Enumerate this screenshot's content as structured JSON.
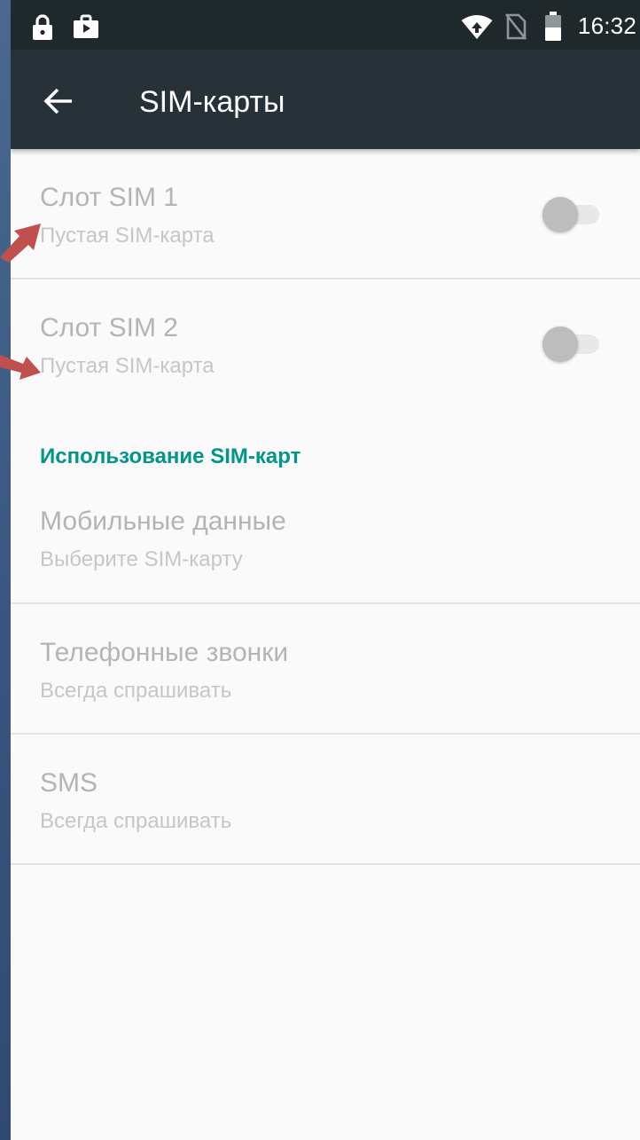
{
  "status_bar": {
    "time": "16:32",
    "icons": [
      "lock-icon",
      "shopping-bag-icon",
      "wifi-icon",
      "no-sim-icon",
      "battery-icon"
    ]
  },
  "app_bar": {
    "title": "SIM-карты",
    "back_icon": "arrow-back-icon"
  },
  "sim_slots": [
    {
      "title": "Слот SIM 1",
      "subtitle": "Пустая SIM-карта",
      "enabled": false
    },
    {
      "title": "Слот SIM 2",
      "subtitle": "Пустая SIM-карта",
      "enabled": false
    }
  ],
  "usage_section": {
    "header": "Использование SIM-карт",
    "items": [
      {
        "title": "Мобильные данные",
        "subtitle": "Выберите SIM-карту"
      },
      {
        "title": "Телефонные звонки",
        "subtitle": "Всегда спрашивать"
      },
      {
        "title": "SMS",
        "subtitle": "Всегда спрашивать"
      }
    ]
  },
  "colors": {
    "status_bar": "#1f292c",
    "app_bar": "#263238",
    "accent": "#009688",
    "background": "#fafafa",
    "annotation_arrow": "#c0504d"
  }
}
